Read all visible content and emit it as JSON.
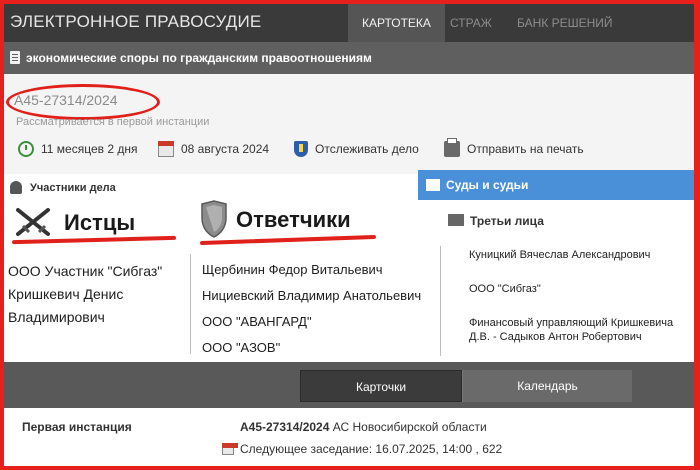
{
  "header": {
    "brand": "ЭЛЕКТРОННОЕ ПРАВОСУДИЕ",
    "nav": [
      {
        "label": "КАРТОТЕКА",
        "active": true
      },
      {
        "label": "СТРАЖ",
        "active": false
      },
      {
        "label": "БАНК РЕШЕНИЙ",
        "active": false
      }
    ]
  },
  "category": {
    "label": "экономические споры по гражданским правоотношениям",
    "icon": "document-icon"
  },
  "case": {
    "number": "А45-27314/2024",
    "status": "Рассматривается в первой инстанции",
    "duration": "11 месяцев 2 дня",
    "date": "08 августа 2024",
    "track_label": "Отслеживать дело",
    "print_label": "Отправить на печать"
  },
  "participants": {
    "header": "Участники дела",
    "plaintiffs_title": "Истцы",
    "defendants_title": "Ответчики",
    "third_title": "Третьи лица",
    "plaintiffs": [
      "ООО Участник \"Сибгаз\"",
      "Кришкевич Денис Владимирович"
    ],
    "defendants": [
      "Щербинин Федор Витальевич",
      "Нициевский Владимир Анатольевич",
      "ООО \"АВАНГАРД\"",
      "ООО \"АЗОВ\""
    ],
    "third_parties": [
      "Куницкий Вячеслав Александрович",
      "ООО \"Сибгаз\"",
      "Финансовый управляющий Кришкевича Д.В. - Садыков Антон Робертович"
    ]
  },
  "courts": {
    "header": "Суды и судьи"
  },
  "tabs": [
    {
      "label": "Карточки",
      "active": true
    },
    {
      "label": "Календарь",
      "active": false
    }
  ],
  "instance": {
    "label": "Первая инстанция",
    "case_number": "А45-27314/2024",
    "court": " АС Новосибирской области",
    "next_session": "Следующее заседание: 16.07.2025, 14:00 , 622"
  },
  "colors": {
    "accent_red": "#e0201a",
    "courts_blue": "#4a90d9",
    "topbar": "#3a3a3a"
  }
}
